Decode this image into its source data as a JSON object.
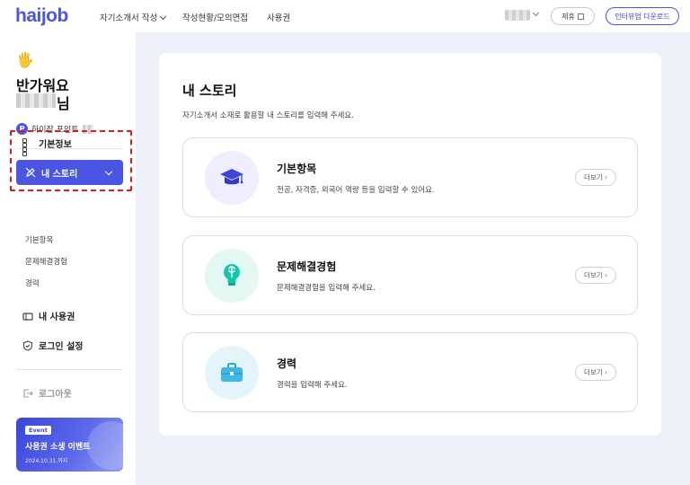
{
  "header": {
    "logo": "haijob",
    "nav": [
      "자기소개서 작성",
      "작성현황/모의면접",
      "사용권"
    ],
    "partner_label": "제휴",
    "download_label": "인터뷰업 다운로드"
  },
  "sidebar": {
    "wave": "🖐",
    "greeting": "반가워요",
    "name_suffix": "님",
    "points_badge": "P",
    "points_label": "하이잡 포인트",
    "menu": {
      "basic_info": "기본정보",
      "my_story": "내 스토리",
      "my_license": "내 사용권",
      "login_settings": "로그인 설정"
    },
    "sub_items": [
      "기본항목",
      "문제해결경험",
      "경력"
    ],
    "logout": "로그아웃",
    "event": {
      "tag": "Event",
      "title": "사용권 소생 이벤트",
      "date": "2024.10.31.까지"
    }
  },
  "main": {
    "title": "내 스토리",
    "subtitle": "자기소개서 소재로 활용할 내 스토리를 입력해 주세요.",
    "cards": [
      {
        "title": "기본항목",
        "desc": "전공, 자격증, 외국어 역량 등을 입력할 수 있어요.",
        "more": "더보기",
        "icon": "graduation-cap-icon",
        "bg": "#eeeefe"
      },
      {
        "title": "문제해결경험",
        "desc": "문제해결경험을 입력해 주세요.",
        "more": "더보기",
        "icon": "lightbulb-icon",
        "bg": "#e3f8f3"
      },
      {
        "title": "경력",
        "desc": "경력을 입력해 주세요.",
        "more": "더보기",
        "icon": "briefcase-icon",
        "bg": "#e3f5fb"
      }
    ]
  },
  "colors": {
    "accent": "#4a56e2",
    "highlight": "#e2181b",
    "teal": "#15c6a7",
    "sky": "#3fb6e3"
  }
}
